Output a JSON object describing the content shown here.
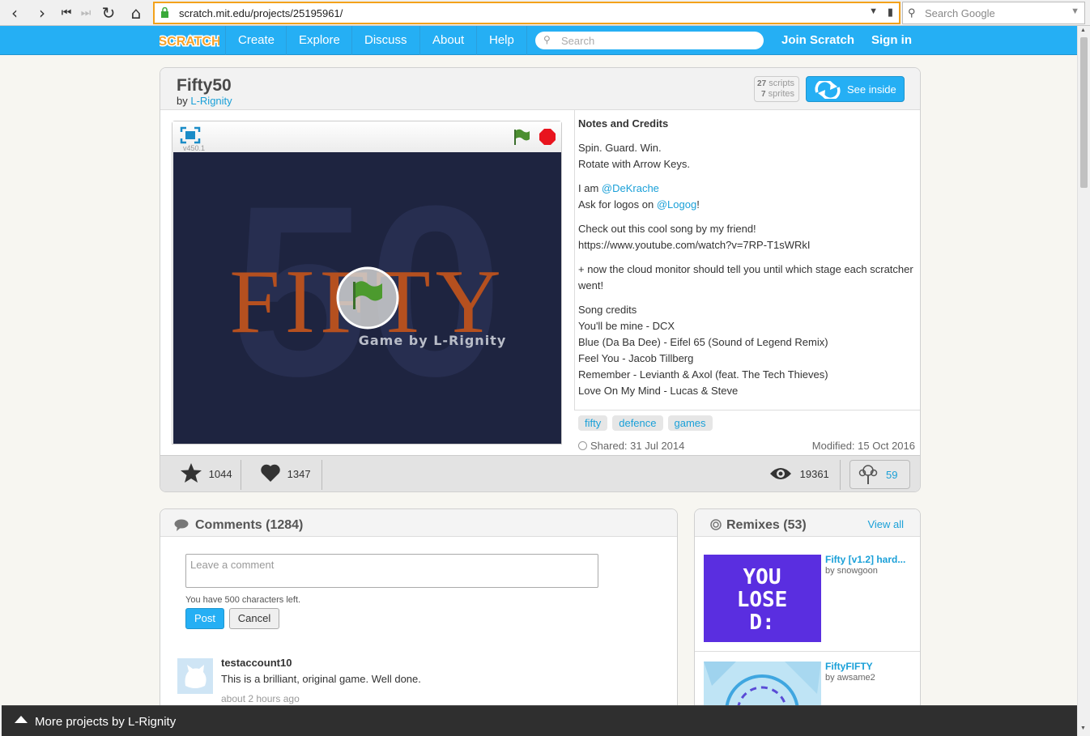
{
  "browser": {
    "url": "scratch.mit.edu/projects/25195961/",
    "search_placeholder": "Search Google"
  },
  "navbar": {
    "logo": "SCRATCH",
    "items": [
      "Create",
      "Explore",
      "Discuss",
      "About",
      "Help"
    ],
    "search_placeholder": "Search",
    "join": "Join Scratch",
    "sign_in": "Sign in"
  },
  "project": {
    "title": "Fifty50",
    "by_prefix": "by",
    "author": "L-Rignity",
    "scripts_count": "27",
    "scripts_label": "scripts",
    "sprites_count": "7",
    "sprites_label": "sprites",
    "see_inside": "See inside",
    "player_version": "v450.1",
    "stage_title": "FIFTY",
    "stage_bg_number": "50",
    "stage_subtitle": "Game by L-Rignity"
  },
  "notes": {
    "heading": "Notes and Credits",
    "line1": "Spin. Guard. Win.",
    "line2": "Rotate with Arrow Keys.",
    "iam_prefix": "I am ",
    "iam_link": "@DeKrache",
    "logos_prefix": "Ask for logos on ",
    "logos_link": "@Logog",
    "logos_suffix": "!",
    "song_intro": "Check out this cool song by my friend!",
    "song_url": "https://www.youtube.com/watch?v=7RP-T1sWRkI",
    "cloud_note": "+ now the cloud monitor should tell you until which stage each scratcher went!",
    "credits_heading": "Song credits",
    "credits": [
      "You'll be mine - DCX",
      "Blue (Da Ba Dee) - Eifel 65 (Sound of Legend Remix)",
      "Feel You - Jacob Tillberg",
      "Remember - Levianth & Axol (feat. The Tech Thieves)",
      "Love On My Mind - Lucas & Steve"
    ]
  },
  "tags": [
    "fifty",
    "defence",
    "games"
  ],
  "dates": {
    "shared": "Shared: 31 Jul 2014",
    "modified": "Modified: 15 Oct 2016"
  },
  "stats": {
    "favorites": "1044",
    "loves": "1347",
    "views": "19361",
    "remixes": "59"
  },
  "comments": {
    "title": "Comments (1284)",
    "placeholder": "Leave a comment",
    "chars_left": "You have 500 characters left.",
    "post": "Post",
    "cancel": "Cancel",
    "items": [
      {
        "user": "testaccount10",
        "text": "This is a brilliant, original game. Well done.",
        "time": "about 2 hours ago"
      }
    ]
  },
  "remixes": {
    "title": "Remixes (53)",
    "view_all": "View all",
    "items": [
      {
        "title": "Fifty [v1.2] hard...",
        "by": "by snowgoon",
        "thumb_text": [
          "YOU",
          "LOSE",
          "D:"
        ]
      },
      {
        "title": "FiftyFIFTY",
        "by": "by awsame2"
      }
    ]
  },
  "footer": {
    "label": "More projects by L-Rignity"
  },
  "colors": {
    "scratch_blue": "#25aff4",
    "link": "#1aa0d8",
    "stage_bg": "#1e2440",
    "stage_title": "#b5501f",
    "remix_thumb_purple": "#5a2ee0"
  }
}
